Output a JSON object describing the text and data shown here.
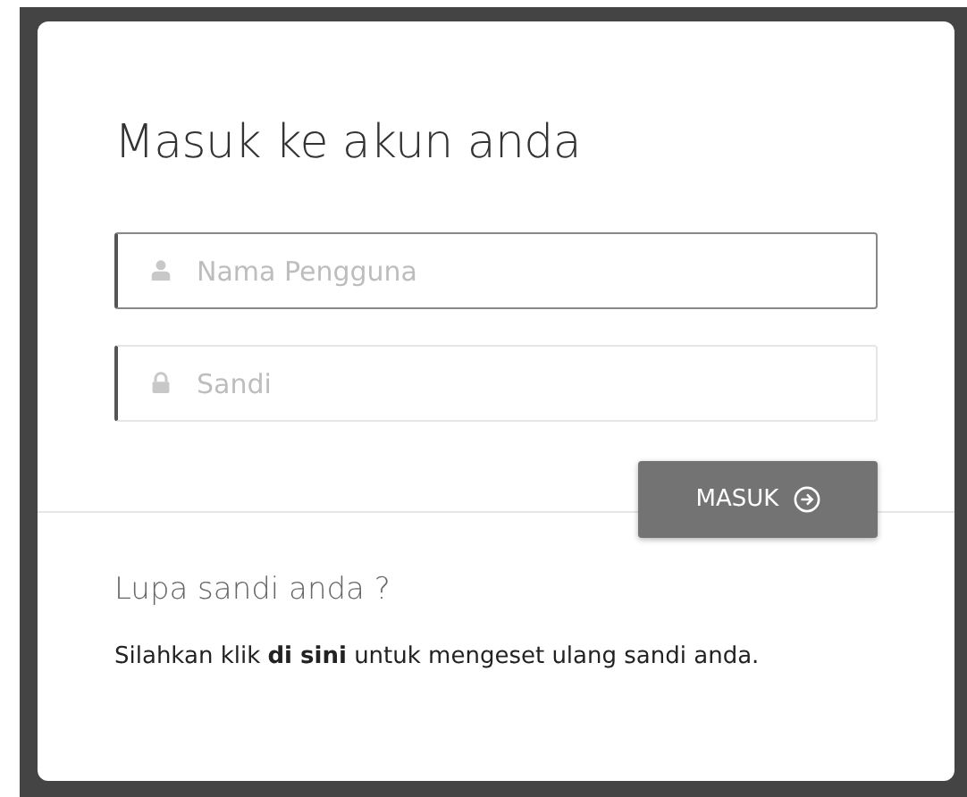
{
  "title": "Masuk ke akun anda",
  "fields": [
    {
      "kind": "user",
      "placeholder": "Nama Pengguna",
      "focused": true
    },
    {
      "kind": "password",
      "placeholder": "Sandi",
      "focused": false
    }
  ],
  "submit": {
    "label": "MASUK"
  },
  "forgot": {
    "heading": "Lupa sandi anda ?",
    "text": "Silahkan klik **di sini** untuk mengeset ulang sandi anda."
  }
}
